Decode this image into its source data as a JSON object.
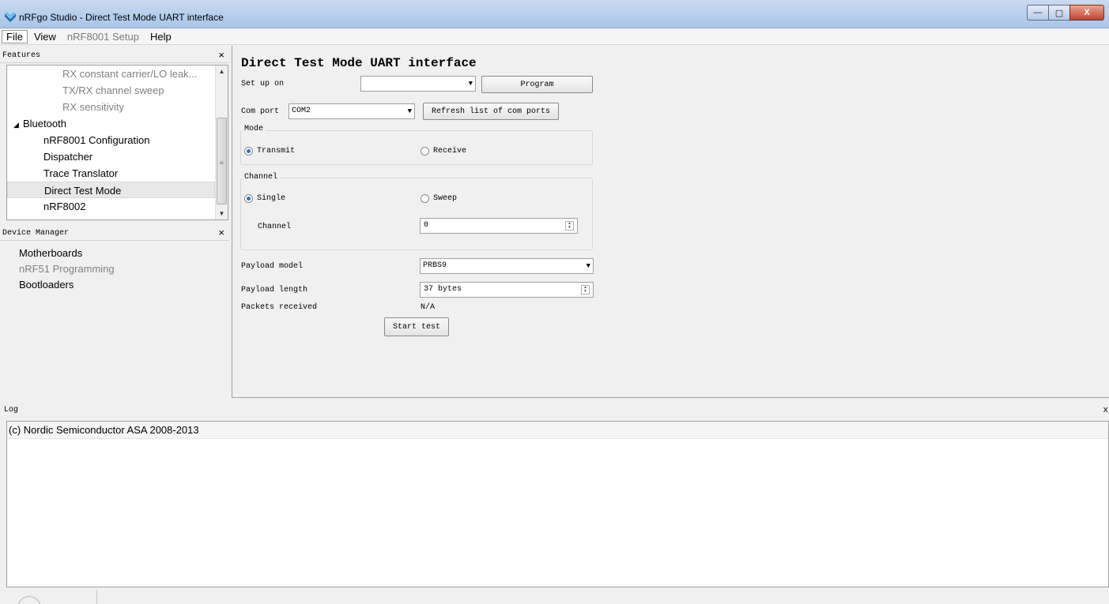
{
  "window": {
    "title": "nRFgo Studio  - Direct Test Mode UART interface",
    "controls": {
      "minimize": "—",
      "maximize": "▢",
      "close": "X"
    }
  },
  "menu": [
    "File",
    "View",
    "nRF8001 Setup",
    "Help"
  ],
  "features": {
    "title": "Features",
    "close": "×",
    "items": [
      {
        "label": "RX constant carrier/LO leak...",
        "level": 2,
        "disabled": true
      },
      {
        "label": "TX/RX channel sweep",
        "level": 2,
        "disabled": true
      },
      {
        "label": "RX sensitivity",
        "level": 2,
        "disabled": true
      },
      {
        "label": "Bluetooth",
        "level": 0,
        "disabled": false,
        "expanded": true
      },
      {
        "label": "nRF8001 Configuration",
        "level": 1,
        "disabled": false
      },
      {
        "label": "Dispatcher",
        "level": 1,
        "disabled": false
      },
      {
        "label": "Trace Translator",
        "level": 1,
        "disabled": false
      },
      {
        "label": "Direct Test Mode",
        "level": 1,
        "disabled": false,
        "selected": true
      },
      {
        "label": "nRF8002",
        "level": 1,
        "disabled": false
      }
    ],
    "scrollbar": {
      "up": "▲",
      "down": "▼",
      "grip": "≡"
    }
  },
  "device_manager": {
    "title": "Device Manager",
    "close": "×",
    "items": [
      {
        "label": "Motherboards",
        "disabled": false
      },
      {
        "label": "nRF51 Programming",
        "disabled": true
      },
      {
        "label": "Bootloaders",
        "disabled": false
      }
    ]
  },
  "main": {
    "title": "Direct Test Mode UART interface",
    "setup_label": "Set up on",
    "setup_value": "",
    "program_button": "Program",
    "comport_label": "Com port",
    "comport_value": "COM2",
    "refresh_button": "Refresh list of com ports",
    "mode": {
      "title": "Mode",
      "options": [
        "Transmit",
        "Receive"
      ],
      "selected": "Transmit"
    },
    "channel_group": {
      "title": "Channel",
      "options": [
        "Single",
        "Sweep"
      ],
      "selected": "Single",
      "channel_label": "Channel",
      "channel_value": "0"
    },
    "payload_model_label": "Payload model",
    "payload_model_value": "PRBS9",
    "payload_length_label": "Payload length",
    "payload_length_value": "37 bytes",
    "packets_received_label": "Packets received",
    "packets_received_value": "N/A",
    "start_button": "Start test",
    "arrow": "▼",
    "spin_up": "▲",
    "spin_down": "▼"
  },
  "log": {
    "title": "Log",
    "close": "x",
    "lines": [
      "(c) Nordic Semiconductor ASA 2008-2013"
    ]
  },
  "colors": {
    "titlebar": "#a9c5e8",
    "radio_checked": "#2d6ec7",
    "panel_bg": "#f0f0f0"
  }
}
